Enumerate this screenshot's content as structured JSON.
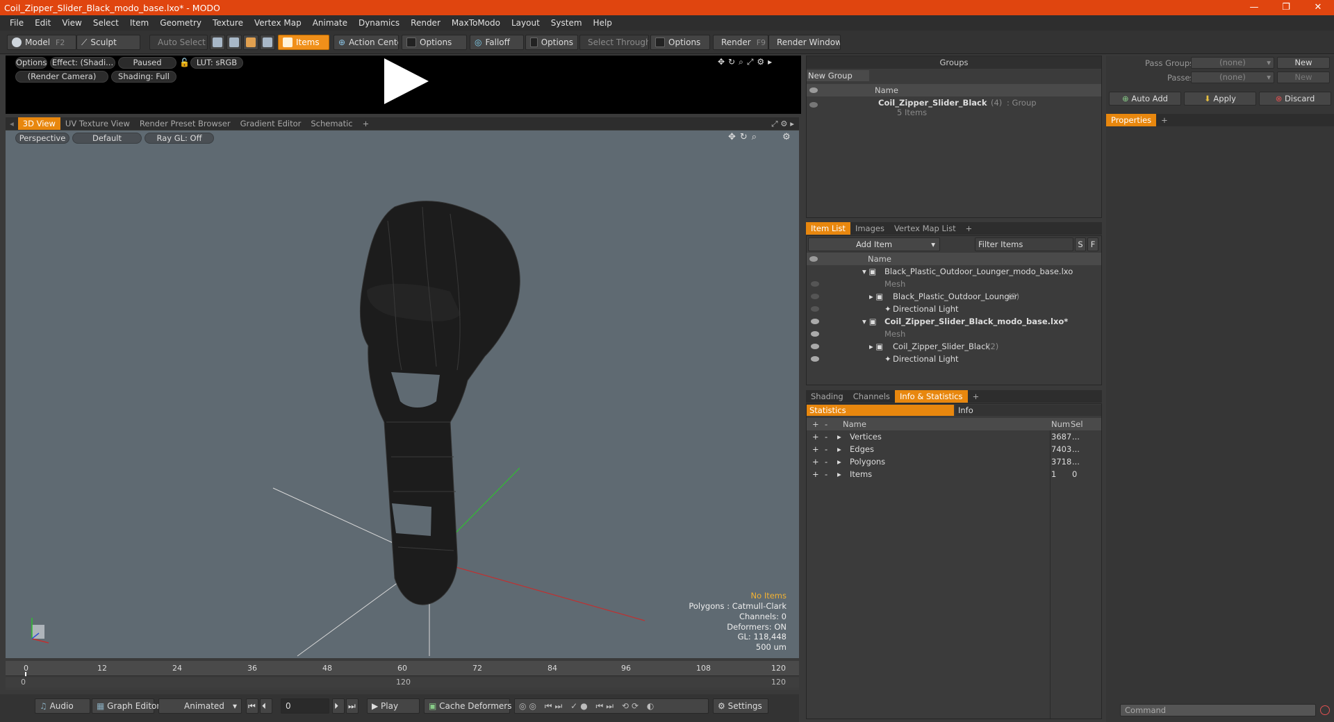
{
  "window": {
    "title": "Coil_Zipper_Slider_Black_modo_base.lxo* - MODO",
    "minimize": "—",
    "maximize": "❐",
    "close": "✕"
  },
  "menu": [
    "File",
    "Edit",
    "View",
    "Select",
    "Item",
    "Geometry",
    "Texture",
    "Vertex Map",
    "Animate",
    "Dynamics",
    "Render",
    "MaxToModo",
    "Layout",
    "System",
    "Help"
  ],
  "toolbar": {
    "model": "Model",
    "model_key": "F2",
    "sculpt": "Sculpt",
    "auto_select": "Auto Select",
    "items": "Items",
    "action_center": "Action Center",
    "options1": "Options",
    "falloff": "Falloff",
    "options2": "Options",
    "select_through": "Select Through",
    "options3": "Options",
    "render": "Render",
    "render_key": "F9",
    "render_window": "Render Window"
  },
  "preview": {
    "options": "Options",
    "effect": "Effect: (Shadi...",
    "paused": "Paused",
    "lut": "LUT: sRGB",
    "camera": "(Render Camera)",
    "shading": "Shading: Full"
  },
  "view_tabs": [
    "3D View",
    "UV Texture View",
    "Render Preset Browser",
    "Gradient Editor",
    "Schematic",
    "+"
  ],
  "viewport": {
    "perspective": "Perspective",
    "default": "Default",
    "raygl": "Ray GL: Off"
  },
  "viewinfo": {
    "no_items": "No Items",
    "polygons": "Polygons : Catmull-Clark",
    "channels": "Channels: 0",
    "deformers": "Deformers: ON",
    "gl": "GL: 118,448",
    "units": "500 um"
  },
  "timeline": {
    "ticks": [
      "0",
      "12",
      "24",
      "36",
      "48",
      "60",
      "72",
      "84",
      "96",
      "108",
      "120"
    ],
    "start": "0",
    "mid": "120",
    "end": "120"
  },
  "bottom": {
    "audio": "Audio",
    "graph_editor": "Graph Editor",
    "animated": "Animated",
    "frame": "0",
    "play": "Play",
    "cache": "Cache Deformers",
    "settings": "Settings"
  },
  "groups": {
    "title": "Groups",
    "new_group": "New Group",
    "name_col": "Name",
    "item_name": "Coil_Zipper_Slider_Black",
    "item_count": "(4)",
    "item_type": ": Group",
    "item_sub": "5 Items"
  },
  "item_list": {
    "tabs": [
      "Item List",
      "Images",
      "Vertex Map List",
      "+"
    ],
    "add_item": "Add Item",
    "filter": "Filter Items",
    "s": "S",
    "f": "F",
    "name_col": "Name",
    "rows": [
      {
        "label": "Black_Plastic_Outdoor_Lounger_modo_base.lxo",
        "extra": ""
      },
      {
        "label": "Mesh",
        "extra": ""
      },
      {
        "label": "Black_Plastic_Outdoor_Lounger",
        "extra": "(2)"
      },
      {
        "label": "Directional Light",
        "extra": ""
      },
      {
        "label": "Coil_Zipper_Slider_Black_modo_base.lxo*",
        "extra": ""
      },
      {
        "label": "Mesh",
        "extra": ""
      },
      {
        "label": "Coil_Zipper_Slider_Black",
        "extra": "(2)"
      },
      {
        "label": "Directional Light",
        "extra": ""
      }
    ]
  },
  "stats": {
    "tabs": [
      "Shading",
      "Channels",
      "Info & Statistics",
      "+"
    ],
    "statistics": "Statistics",
    "info": "Info",
    "cols": {
      "name": "Name",
      "num": "Num",
      "sel": "Sel"
    },
    "rows": [
      {
        "name": "Vertices",
        "num": "3687",
        "sel": "..."
      },
      {
        "name": "Edges",
        "num": "7403",
        "sel": "..."
      },
      {
        "name": "Polygons",
        "num": "3718",
        "sel": "..."
      },
      {
        "name": "Items",
        "num": "1",
        "sel": "0"
      }
    ]
  },
  "right": {
    "pass_groups": "Pass Groups",
    "pass_groups_val": "(none)",
    "new1": "New",
    "passes": "Passes",
    "passes_val": "(none)",
    "new2": "New",
    "auto_add": "Auto Add",
    "apply": "Apply",
    "discard": "Discard",
    "properties": "Properties",
    "plus": "+",
    "command": "Command"
  }
}
